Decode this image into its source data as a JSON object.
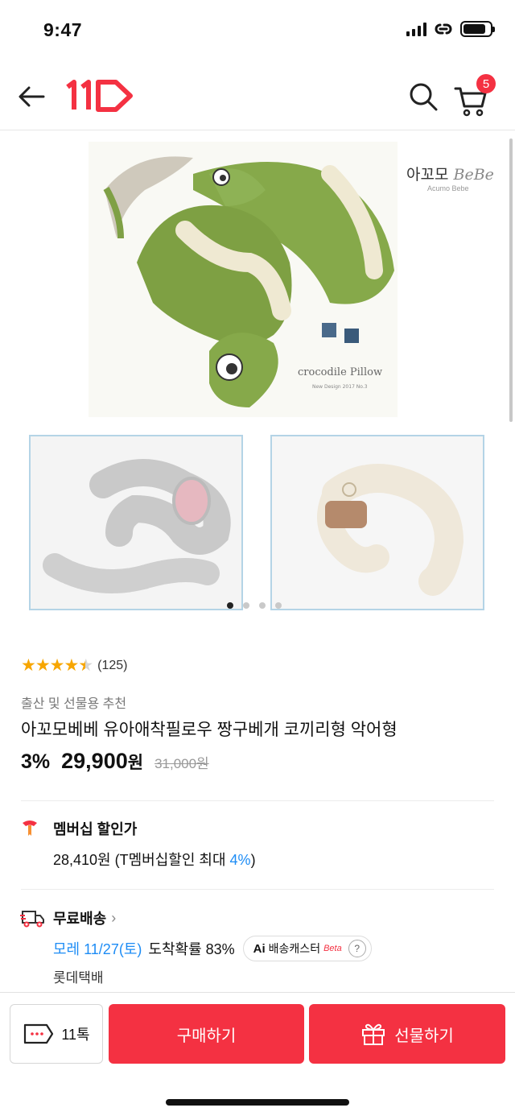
{
  "status_bar": {
    "time": "9:47",
    "battery_level": 0.85
  },
  "header": {
    "logo_text": "11",
    "cart_count": "5",
    "icons": [
      "back-arrow-icon",
      "search-icon",
      "cart-icon"
    ]
  },
  "colors": {
    "brand_red": "#f43142",
    "accent_blue": "#1d8cf5",
    "star": "#f7a600"
  },
  "gallery": {
    "brand_name_kr": "아꼬모",
    "brand_name_en": "BeBe",
    "brand_sub": "Acumo Bebe",
    "main_caption": "crocodile Pillow",
    "main_caption_sub": "New Design 2017 No.3",
    "page_count": 4,
    "active_page": 1
  },
  "product": {
    "rating": 4.5,
    "review_count": "(125)",
    "category": "출산 및 선물용 추천",
    "title": "아꼬모베베 유아애착필로우 짱구베개 코끼리형 악어형",
    "discount": "3%",
    "price": "29,900",
    "price_unit": "원",
    "original_price": "31,000원"
  },
  "membership": {
    "label": "멤버십 할인가",
    "price": "28,410원",
    "detail_prefix": " (T멤버십할인 최대 ",
    "detail_rate": "4%",
    "detail_suffix": ")"
  },
  "shipping": {
    "label": "무료배송",
    "chevron": "›",
    "date": "모레 11/27(토)",
    "probability": "도착확률 83%",
    "ai_label": "Ai",
    "caster_label": "배송캐스터",
    "beta_label": "Beta",
    "help": "?",
    "carrier": "롯데택배"
  },
  "bottom_bar": {
    "talk_label": "11톡",
    "buy_label": "구매하기",
    "gift_label": "선물하기"
  }
}
